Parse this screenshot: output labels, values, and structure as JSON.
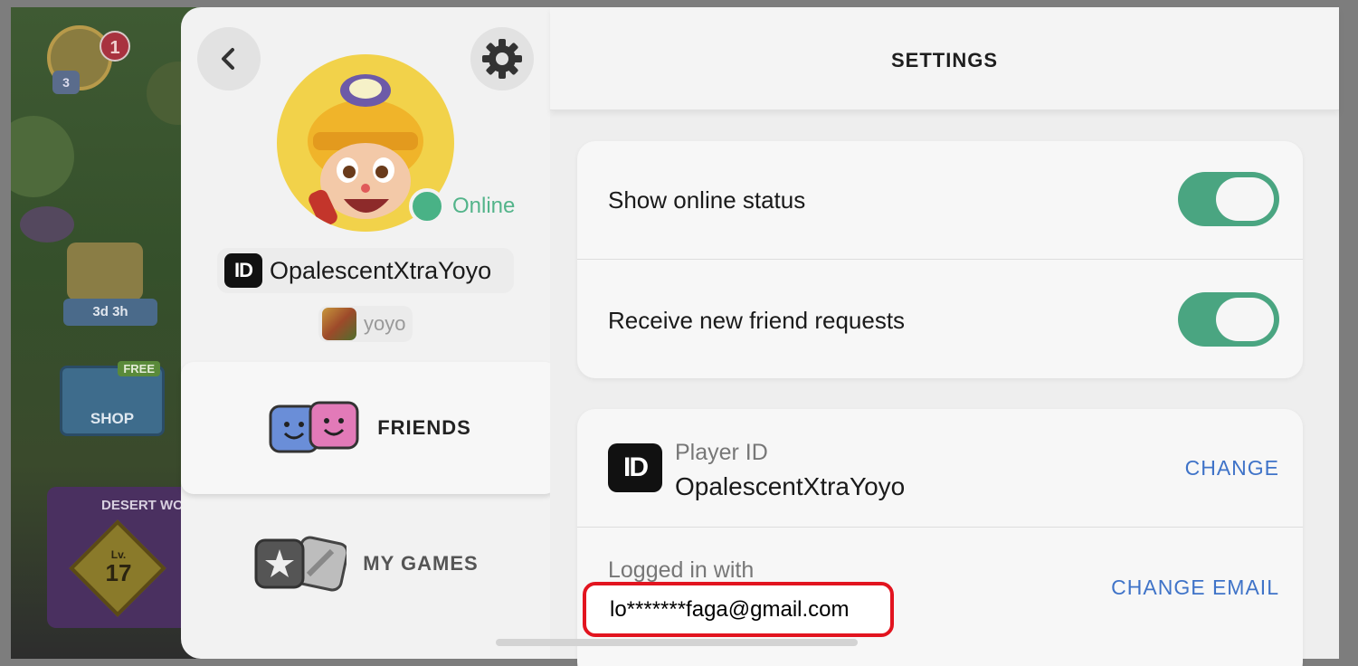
{
  "game": {
    "badge_count": "1",
    "player_level": "3",
    "timer": "3d 3h",
    "shop_free": "FREE",
    "shop_label": "SHOP",
    "event_title": "DESERT WO",
    "event_level_prefix": "Lv.",
    "event_level": "17"
  },
  "sidebar": {
    "status": "Online",
    "player_name": "OpalescentXtraYoyo",
    "id_badge": "ID",
    "game_name": "yoyo",
    "nav": [
      {
        "label": "FRIENDS",
        "active": true
      },
      {
        "label": "MY GAMES",
        "active": false
      }
    ]
  },
  "settings": {
    "title": "SETTINGS",
    "toggles": [
      {
        "label": "Show online status",
        "on": true
      },
      {
        "label": "Receive new friend requests",
        "on": true
      }
    ],
    "player_id": {
      "caption": "Player ID",
      "value": "OpalescentXtraYoyo",
      "action": "CHANGE"
    },
    "login": {
      "caption": "Logged in with",
      "email": "lo*******faga@gmail.com",
      "action": "CHANGE EMAIL"
    }
  },
  "colors": {
    "accent_green": "#4aa581",
    "link_blue": "#3f73c8",
    "highlight_red": "#e2141f"
  }
}
